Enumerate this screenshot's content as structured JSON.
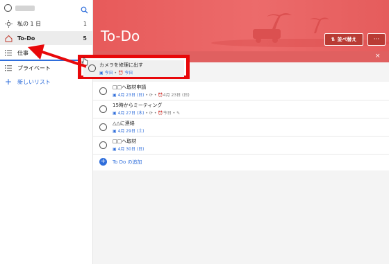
{
  "sidebar": {
    "search_icon": "search-icon",
    "items": [
      {
        "label": "私の 1 日",
        "count": "1",
        "icon": "sun-icon"
      },
      {
        "label": "To-Do",
        "count": "5",
        "icon": "home-icon"
      },
      {
        "label": "仕事",
        "count": "",
        "icon": "list-icon"
      },
      {
        "label": "プライベート",
        "count": "",
        "icon": "list-icon"
      }
    ],
    "new_list_label": "新しいリスト"
  },
  "header": {
    "title": "To-Do",
    "sort_label": "並べ替え",
    "more_label": "···",
    "close_label": "×"
  },
  "dragged_task": {
    "title": "カメラを修理に出す",
    "meta_due": "今日",
    "meta_reminder": "今日"
  },
  "tasks": [
    {
      "title": "□□へ取材申請",
      "meta": "4月 23日 (日)",
      "meta2": "4月 23日 (日)"
    },
    {
      "title": "15時からミーティング",
      "meta": "4月 27日 (木)",
      "meta2": "今日"
    },
    {
      "title": "△△に連絡",
      "meta": "4月 29日 (土)",
      "meta2": ""
    },
    {
      "title": "□□へ取材",
      "meta": "4月 30日 (日)",
      "meta2": ""
    }
  ],
  "add_label": "To Do の追加",
  "colors": {
    "accent": "#2f6edb",
    "banner": "#e75a5a",
    "highlight": "#e8080a"
  }
}
